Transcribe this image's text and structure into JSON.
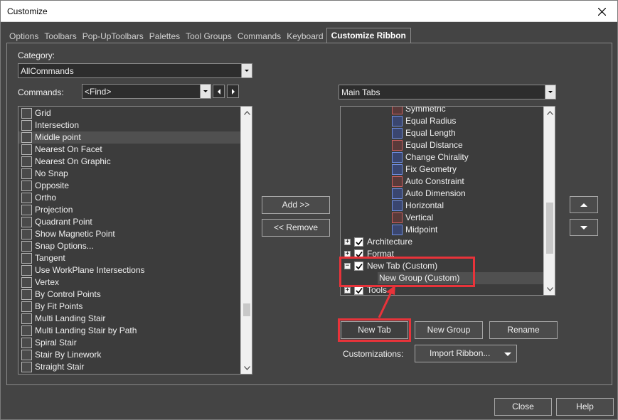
{
  "window": {
    "title": "Customize"
  },
  "tabs": [
    {
      "label": "Options",
      "hotkey": "O",
      "rest": "ptions",
      "active": false
    },
    {
      "label": "Toolbars",
      "hotkey": "",
      "rest": "",
      "active": false
    },
    {
      "label": "Pop-UpToolbars",
      "active": false
    },
    {
      "label": "Palettes",
      "active": false
    },
    {
      "label": "Tool Groups",
      "active": false
    },
    {
      "label": "Commands",
      "active": false
    },
    {
      "label": "Keyboard",
      "active": false
    },
    {
      "label": "Customize Ribbon",
      "active": true
    }
  ],
  "left": {
    "category_label": "Category:",
    "category_value": "AllCommands",
    "commands_label": "Commands:",
    "find_value": "<Find>",
    "commands": [
      "Grid",
      "Intersection",
      "Middle point",
      "Nearest On Facet",
      "Nearest On Graphic",
      "No Snap",
      "Opposite",
      "Ortho",
      "Projection",
      "Quadrant Point",
      "Show Magnetic Point",
      "Snap Options...",
      "Tangent",
      "Use WorkPlane Intersections",
      "Vertex",
      "By Control Points",
      "By Fit Points",
      "Multi Landing Stair",
      "Multi Landing Stair by Path",
      "Spiral Stair",
      "Stair By Linework",
      "Straight Stair"
    ],
    "selected_command": "Middle point"
  },
  "middle": {
    "add_label": "Add >>",
    "remove_label": "<< Remove"
  },
  "right": {
    "tabs_combo_value": "Main Tabs",
    "tree": {
      "constraints": [
        "Symmetric",
        "Equal Radius",
        "Equal Length",
        "Equal Distance",
        "Change Chirality",
        "Fix Geometry",
        "Auto Constraint",
        "Auto Dimension",
        "Horizontal",
        "Vertical",
        "Midpoint"
      ],
      "tabs": [
        {
          "label": "Architecture",
          "expander": "+",
          "checked": true
        },
        {
          "label": "Format",
          "expander": "+",
          "checked": true
        },
        {
          "label": "New Tab (Custom)",
          "expander": "−",
          "checked": true
        },
        {
          "label": "Tools",
          "expander": "+",
          "checked": true
        }
      ],
      "new_group_label": "New Group (Custom)"
    },
    "new_tab_label": "New Tab",
    "new_group_label": "New Group",
    "rename_label": "Rename",
    "customizations_label": "Customizations:",
    "import_label": "Import Ribbon..."
  },
  "footer": {
    "close_label": "Close",
    "help_label": "Help"
  },
  "colors": {
    "highlight": "#e8333a",
    "panel": "#444444",
    "list": "#3c3c3c"
  }
}
